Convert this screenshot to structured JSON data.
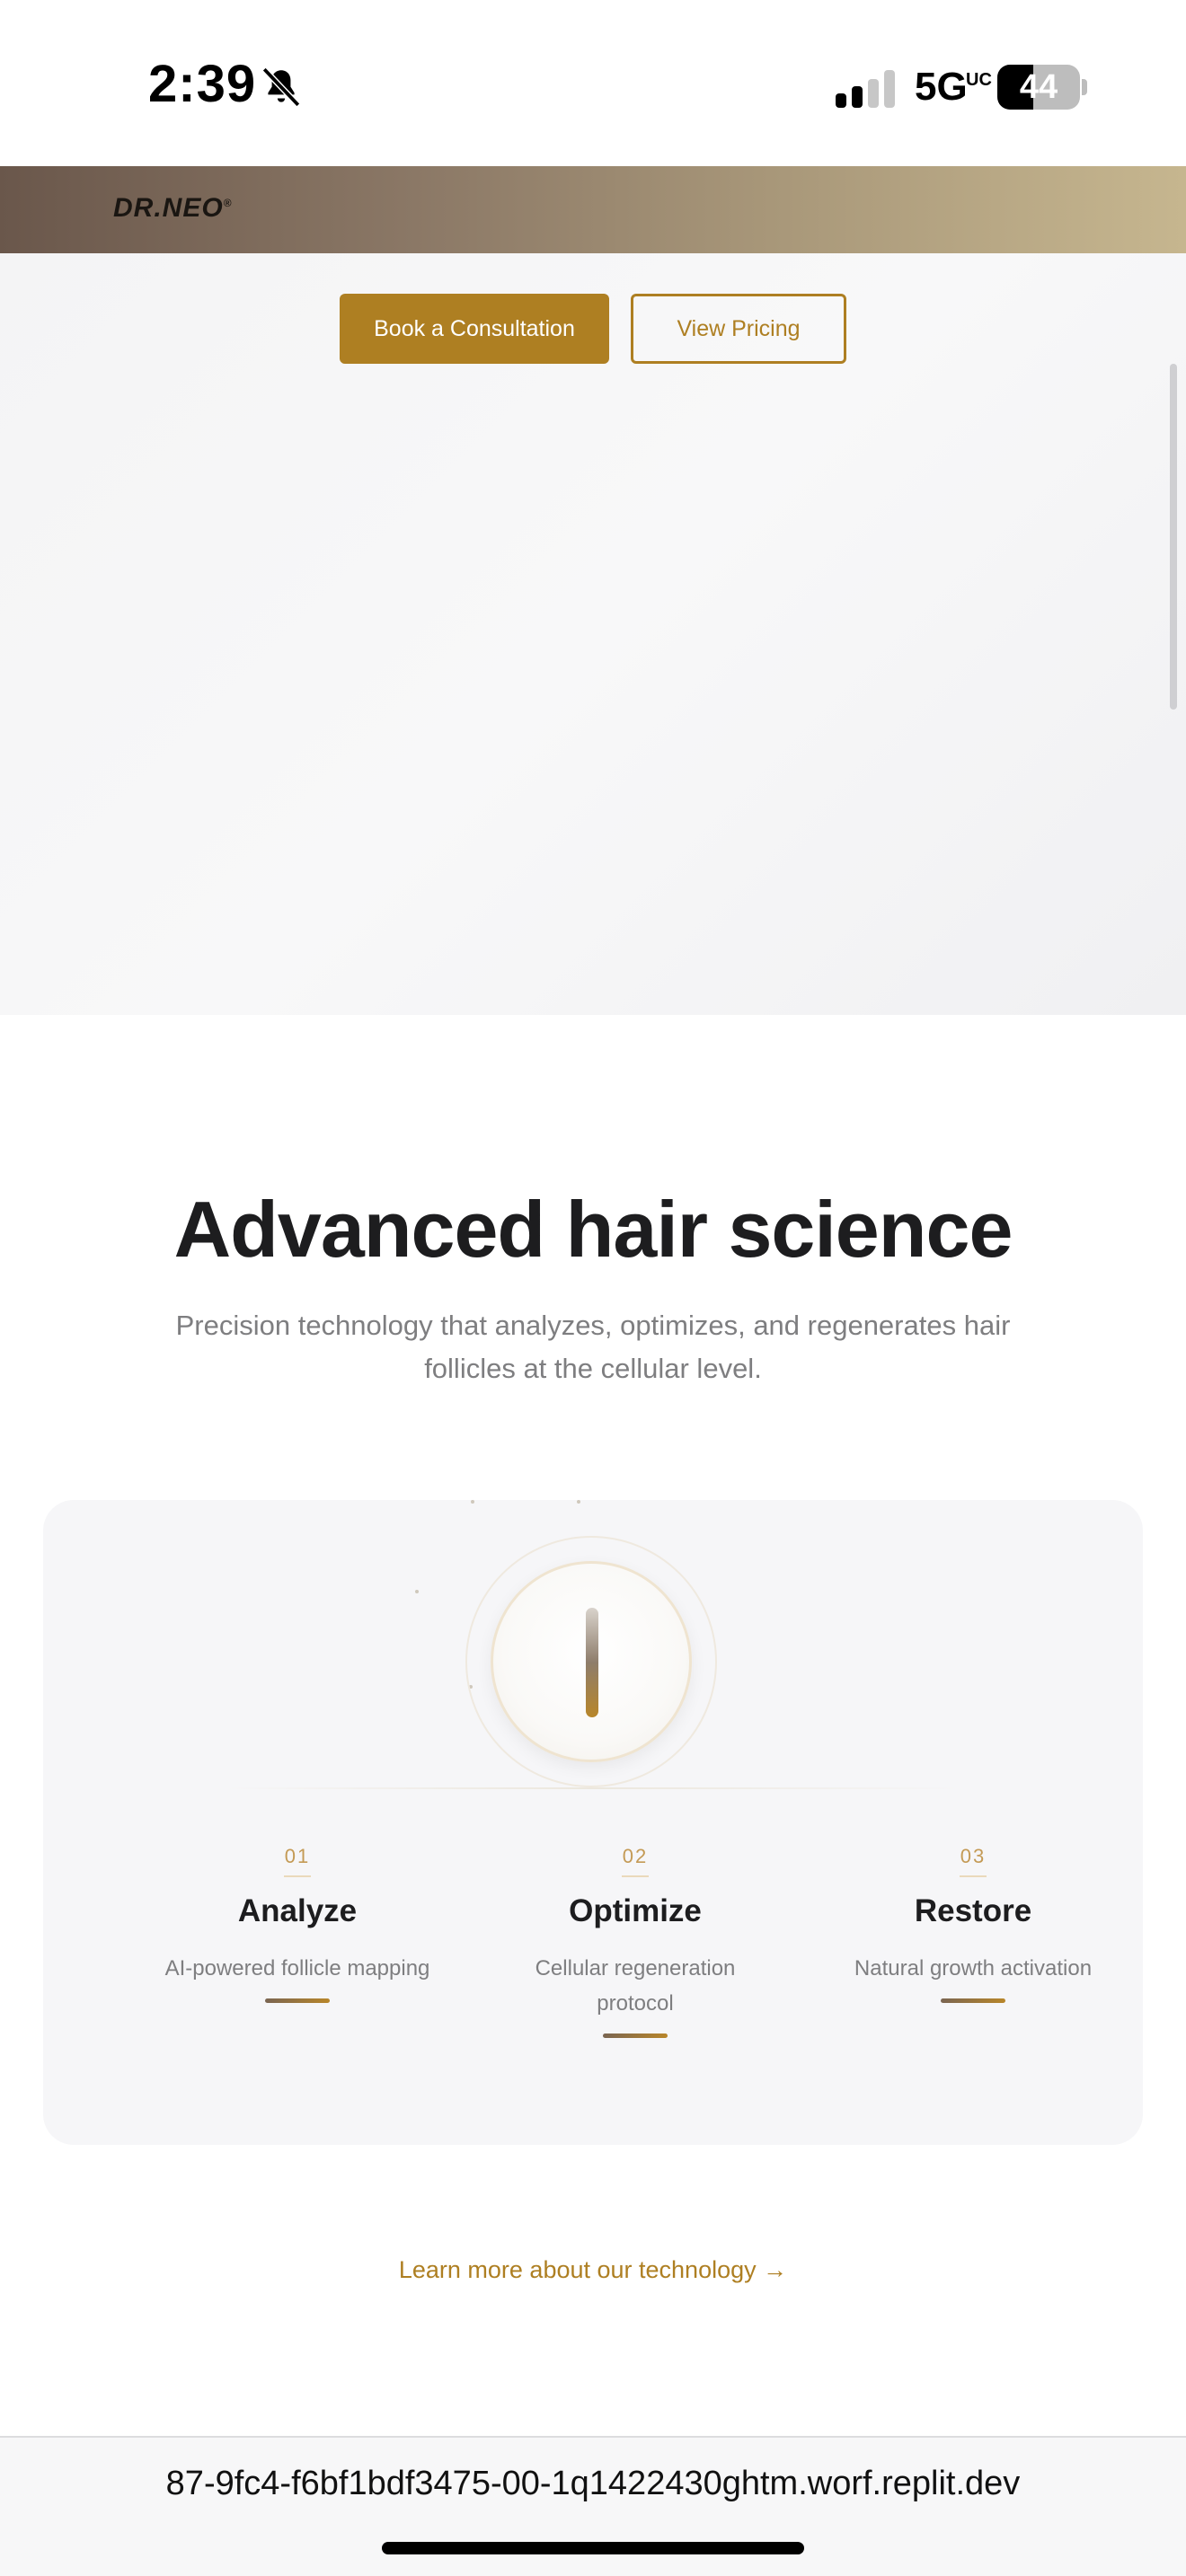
{
  "status_bar": {
    "time": "2:39",
    "network": "5G",
    "network_badge": "UC",
    "battery": "44",
    "battery_level": 0.44,
    "signal_bars": 2,
    "icons": [
      "bell-slash-icon",
      "signal-icon",
      "battery-icon"
    ]
  },
  "header": {
    "logo": "DR.NEO",
    "logo_mark": "®"
  },
  "hero": {
    "primary_button": "Book a Consultation",
    "secondary_button": "View Pricing"
  },
  "science": {
    "title": "Advanced hair science",
    "subtitle": "Precision technology that analyzes, optimizes, and regenerates hair follicles at the cellular level.",
    "steps": [
      {
        "number": "01",
        "title": "Analyze",
        "description": "AI-powered follicle mapping"
      },
      {
        "number": "02",
        "title": "Optimize",
        "description": "Cellular regeneration protocol"
      },
      {
        "number": "03",
        "title": "Restore",
        "description": "Natural growth activation"
      }
    ],
    "link": "Learn more about our technology →"
  },
  "browser": {
    "url": "87-9fc4-f6bf1bdf3475-00-1q1422430ghtm.worf.replit.dev"
  },
  "colors": {
    "accent": "#ae7f22",
    "band_start": "#6a574b",
    "band_end": "#c6b68f",
    "text_dark": "#1d1d1f",
    "text_muted": "#7e7e80"
  }
}
